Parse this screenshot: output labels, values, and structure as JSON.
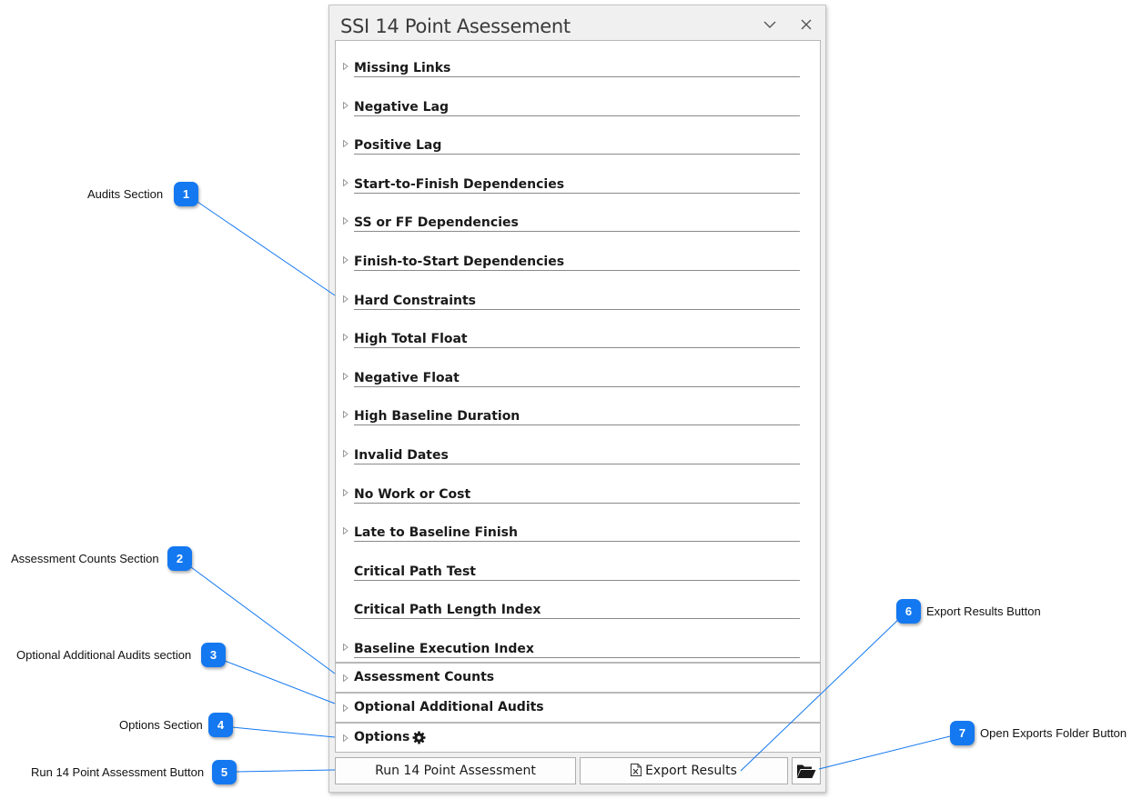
{
  "pane": {
    "title": "SSI 14 Point Asessement",
    "collapse_icon": "chevron-down-icon",
    "close_icon": "close-icon"
  },
  "audits": [
    {
      "label": "Missing Links",
      "expandable": true
    },
    {
      "label": "Negative Lag",
      "expandable": true
    },
    {
      "label": "Positive Lag",
      "expandable": true
    },
    {
      "label": "Start-to-Finish Dependencies",
      "expandable": true
    },
    {
      "label": "SS or FF Dependencies",
      "expandable": true
    },
    {
      "label": "Finish-to-Start Dependencies",
      "expandable": true
    },
    {
      "label": "Hard Constraints",
      "expandable": true
    },
    {
      "label": "High Total Float",
      "expandable": true
    },
    {
      "label": "Negative Float",
      "expandable": true
    },
    {
      "label": "High Baseline Duration",
      "expandable": true
    },
    {
      "label": "Invalid Dates",
      "expandable": true
    },
    {
      "label": "No Work or Cost",
      "expandable": true
    },
    {
      "label": "Late to Baseline Finish",
      "expandable": true
    },
    {
      "label": "Critical Path Test",
      "expandable": false
    },
    {
      "label": "Critical Path Length Index",
      "expandable": false
    },
    {
      "label": "Baseline Execution Index",
      "expandable": true
    }
  ],
  "sections": {
    "assessment_counts": "Assessment Counts",
    "optional_audits": "Optional Additional Audits",
    "options": "Options",
    "options_icon": "gear-icon"
  },
  "buttons": {
    "run": "Run 14 Point Assessment",
    "export": "Export Results",
    "export_icon": "excel-file-icon",
    "open_folder_icon": "folder-open-icon"
  },
  "annotations": [
    {
      "number": "1",
      "label": "Audits Section"
    },
    {
      "number": "2",
      "label": "Assessment Counts Section"
    },
    {
      "number": "3",
      "label": "Optional Additional Audits section"
    },
    {
      "number": "4",
      "label": "Options Section"
    },
    {
      "number": "5",
      "label": "Run 14 Point Assessment Button"
    },
    {
      "number": "6",
      "label": "Export Results Button"
    },
    {
      "number": "7",
      "label": "Open Exports Folder Button"
    }
  ],
  "colors": {
    "callout": "#1478f0",
    "leader_line": "#1478f0"
  }
}
